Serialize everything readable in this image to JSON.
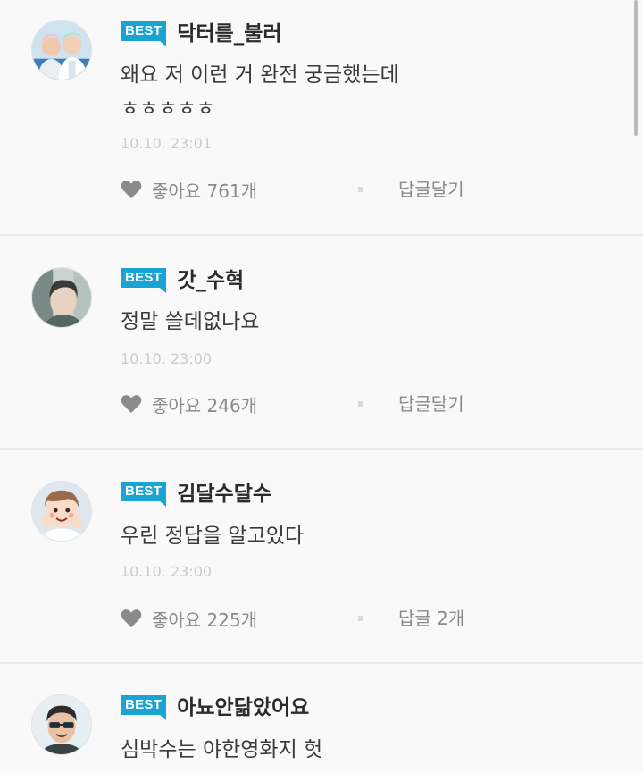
{
  "badge_label": "BEST",
  "comments": [
    {
      "nickname": "닥터를_불러",
      "text_lines": [
        "왜요 저 이런 거 완전 궁금했는데",
        "ㅎㅎㅎㅎㅎ"
      ],
      "timestamp": "10.10. 23:01",
      "likes": "좋아요 761개",
      "reply": "답글달기",
      "avatar_icon": "avatar-two-men-icon"
    },
    {
      "nickname": "갓_수혁",
      "text_lines": [
        "정말 쓸데없나요"
      ],
      "timestamp": "10.10. 23:00",
      "likes": "좋아요 246개",
      "reply": "답글달기",
      "avatar_icon": "avatar-man-icon"
    },
    {
      "nickname": "김달수달수",
      "text_lines": [
        "우린 정답을 알고있다"
      ],
      "timestamp": "10.10. 23:00",
      "likes": "좋아요 225개",
      "reply": "답글 2개",
      "avatar_icon": "avatar-cartoon-icon"
    },
    {
      "nickname": "아뇨안닮았어요",
      "text_lines": [
        "심박수는 야한영화지 헛"
      ],
      "avatar_icon": "avatar-sunglasses-icon"
    }
  ],
  "colors": {
    "badge": "#1aa4d3",
    "background": "#f8f9f8",
    "meta_text": "#8a8a8a",
    "timestamp": "#c9cbca"
  }
}
